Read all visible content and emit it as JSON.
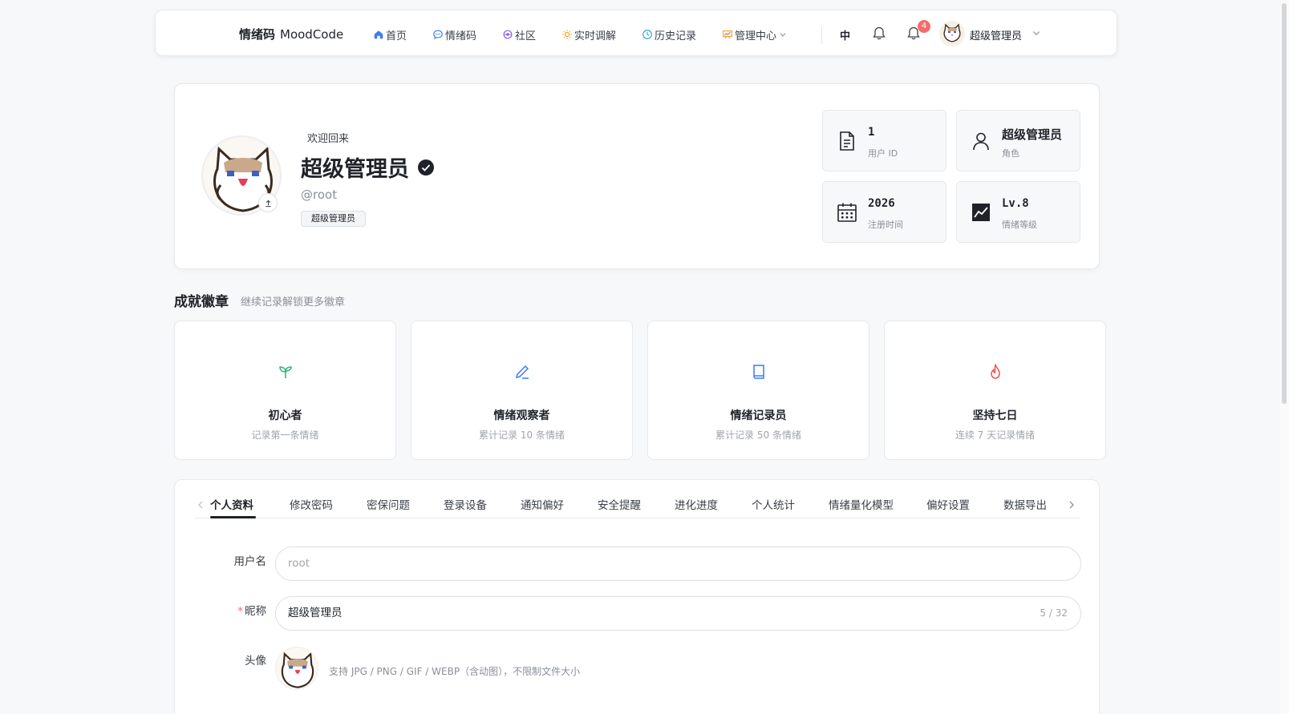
{
  "nav": {
    "brand_cn": "情绪码",
    "brand_en": "MoodCode",
    "items": [
      {
        "label": "首页",
        "icon": "home-icon"
      },
      {
        "label": "情绪码",
        "icon": "chat-bubble-icon"
      },
      {
        "label": "社区",
        "icon": "community-icon"
      },
      {
        "label": "实时调解",
        "icon": "sun-icon"
      },
      {
        "label": "历史记录",
        "icon": "clock-icon"
      },
      {
        "label": "管理中心",
        "icon": "dashboard-icon"
      }
    ],
    "lang": "中",
    "notification_count": "4",
    "user_name": "超级管理员"
  },
  "profile": {
    "welcome": "欢迎回来",
    "display_name": "超级管理员",
    "handle": "@root",
    "role_tag": "超级管理员",
    "stats": [
      {
        "value": "1",
        "label": "用户 ID",
        "icon": "document-icon"
      },
      {
        "value": "超级管理员",
        "label": "角色",
        "icon": "user-icon"
      },
      {
        "value": "2026",
        "label": "注册时间",
        "icon": "calendar-icon"
      },
      {
        "value": "Lv.8",
        "label": "情绪等级",
        "icon": "trend-chart-icon"
      }
    ]
  },
  "achievements": {
    "title": "成就徽章",
    "subtitle": "继续记录解锁更多徽章",
    "items": [
      {
        "title": "初心者",
        "desc": "记录第一条情绪",
        "icon": "sprout-icon",
        "color": "#2bb673"
      },
      {
        "title": "情绪观察者",
        "desc": "累计记录 10 条情绪",
        "icon": "pencil-icon",
        "color": "#3b7bf6"
      },
      {
        "title": "情绪记录员",
        "desc": "累计记录 50 条情绪",
        "icon": "book-icon",
        "color": "#3b7bf6"
      },
      {
        "title": "坚持七日",
        "desc": "连续 7 天记录情绪",
        "icon": "flame-icon",
        "color": "#f0524f"
      }
    ]
  },
  "settings": {
    "tabs": [
      "个人资料",
      "修改密码",
      "密保问题",
      "登录设备",
      "通知偏好",
      "安全提醒",
      "进化进度",
      "个人统计",
      "情绪量化模型",
      "偏好设置",
      "数据导出"
    ],
    "active_tab": "个人资料",
    "form": {
      "username_label": "用户名",
      "username_value": "root",
      "nickname_label": "昵称",
      "nickname_value": "超级管理员",
      "nickname_counter": "5 / 32",
      "avatar_label": "头像",
      "avatar_hint": "支持 JPG / PNG / GIF / WEBP（含动图），不限制文件大小"
    }
  },
  "colors": {
    "accent": "#1f2329",
    "required": "#f56c6c",
    "badge": "#f56c6c"
  }
}
